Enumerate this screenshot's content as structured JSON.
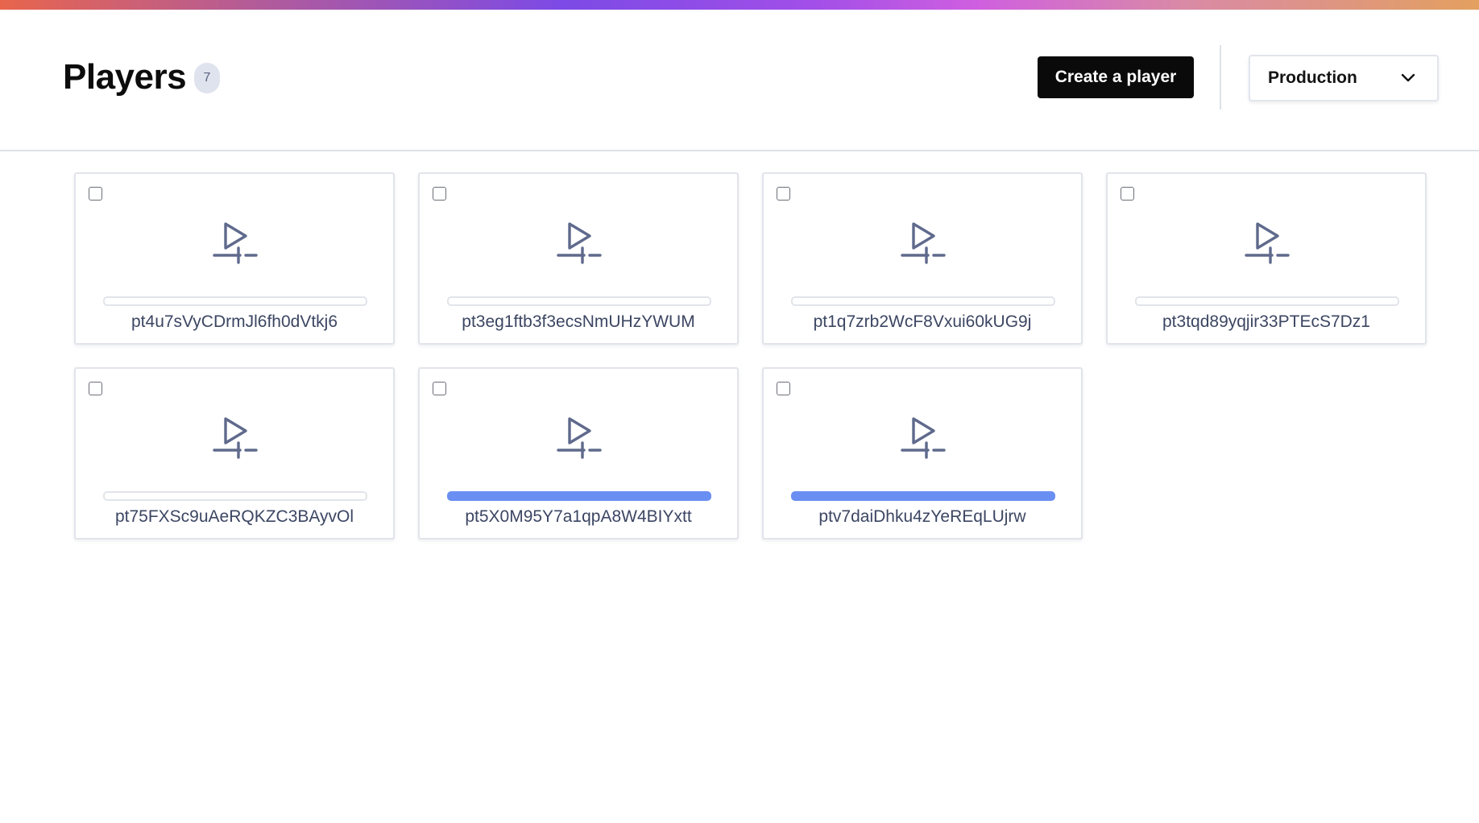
{
  "page": {
    "title": "Players",
    "count": "7"
  },
  "header": {
    "create_button_label": "Create a player",
    "environment": {
      "selected": "Production",
      "icon": "chevron-down-icon"
    }
  },
  "colors": {
    "accent_progress": "#6a8ff2",
    "icon_color": "#5f6a8c",
    "button_bg": "#0a0a0a"
  },
  "players": [
    {
      "id": "pt4u7sVyCDrmJl6fh0dVtkj6",
      "progress": 0,
      "icon": "player-icon"
    },
    {
      "id": "pt3eg1ftb3f3ecsNmUHzYWUM",
      "progress": 0,
      "icon": "player-icon"
    },
    {
      "id": "pt1q7zrb2WcF8Vxui60kUG9j",
      "progress": 0,
      "icon": "player-icon"
    },
    {
      "id": "pt3tqd89yqjir33PTEcS7Dz1",
      "progress": 0,
      "icon": "player-icon"
    },
    {
      "id": "pt75FXSc9uAeRQKZC3BAyvOl",
      "progress": 0,
      "icon": "player-icon"
    },
    {
      "id": "pt5X0M95Y7a1qpA8W4BIYxtt",
      "progress": 1,
      "icon": "player-icon"
    },
    {
      "id": "ptv7daiDhku4zYeREqLUjrw",
      "progress": 1,
      "icon": "player-icon"
    }
  ]
}
